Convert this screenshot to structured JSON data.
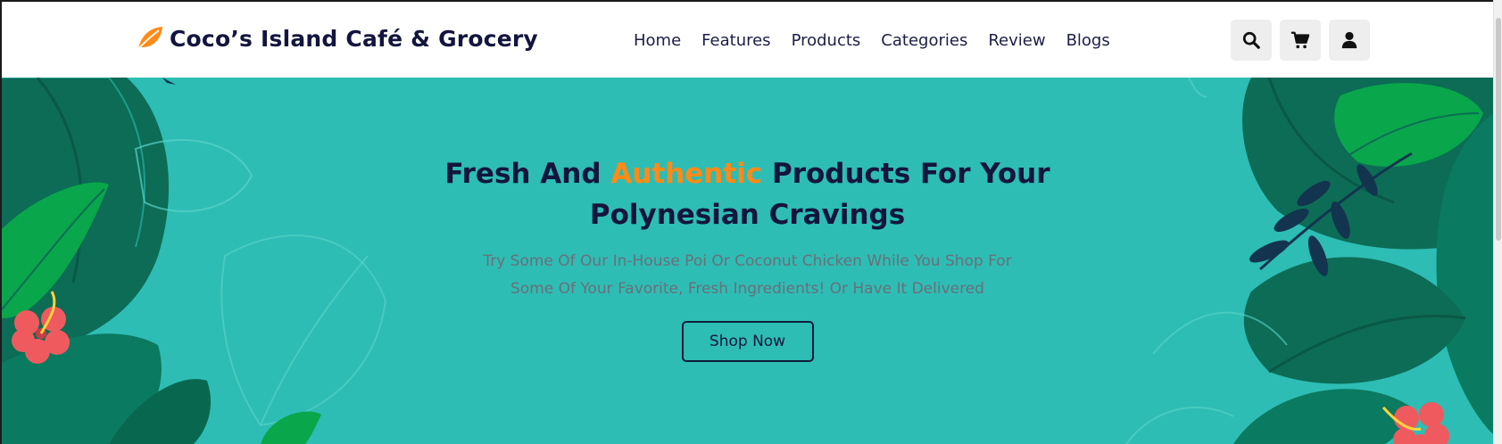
{
  "header": {
    "brand": "Coco’s Island Café & Grocery",
    "brand_icon": "leaf-icon",
    "nav": [
      "Home",
      "Features",
      "Products",
      "Categories",
      "Review",
      "Blogs"
    ],
    "icons": [
      "search-icon",
      "cart-icon",
      "user-icon"
    ]
  },
  "hero": {
    "title_pre": "Fresh And ",
    "title_accent": "Authentic",
    "title_post": " Products For Your",
    "title_line2": "Polynesian Cravings",
    "subtitle": "Try Some Of Our In-House Poi Or Coconut Chicken While You Shop For Some Of Your Favorite, Fresh Ingredients! Or Have It Delivered",
    "button": "Shop Now"
  },
  "colors": {
    "accent": "#ff8a17",
    "navy": "#13153f",
    "hero_bg": "#2dbdb4",
    "leaf_dark": "#0c6c56",
    "leaf_green": "#09a64b",
    "flower": "#ef5a5f"
  }
}
